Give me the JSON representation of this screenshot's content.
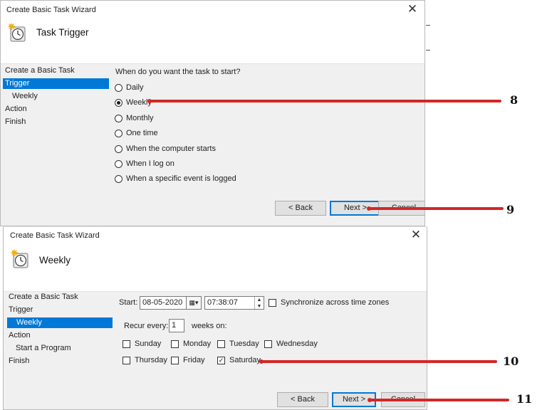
{
  "window1": {
    "title": "Create Basic Task Wizard",
    "close_symbol": "✕",
    "header_title": "Task Trigger",
    "header_icon": "task-scheduler-clock-icon",
    "nav": [
      "Create a Basic Task",
      "Trigger",
      "Weekly",
      "Action",
      "Finish"
    ],
    "nav_active": "Trigger",
    "question": "When do you want the task to start?",
    "options": [
      "Daily",
      "Weekly",
      "Monthly",
      "One time",
      "When the computer starts",
      "When I log on",
      "When a specific event is logged"
    ],
    "selected_option": "Weekly",
    "buttons": {
      "back": "< Back",
      "next": "Next >",
      "cancel": "Cancel"
    }
  },
  "window2": {
    "title": "Create Basic Task Wizard",
    "close_symbol": "✕",
    "header_title": "Weekly",
    "header_icon": "task-scheduler-clock-icon",
    "nav": [
      "Create a Basic Task",
      "Trigger",
      "Weekly",
      "Action",
      "Start a Program",
      "Finish"
    ],
    "nav_active": "Weekly",
    "start_label": "Start:",
    "start_date": "08-05-2020",
    "start_time": "07:38:07",
    "sync_label": "Synchronize across time zones",
    "recur_label": "Recur every:",
    "recur_value": "1",
    "weeks_on_label": "weeks on:",
    "days": [
      {
        "label": "Sunday",
        "checked": false
      },
      {
        "label": "Monday",
        "checked": false
      },
      {
        "label": "Tuesday",
        "checked": false
      },
      {
        "label": "Wednesday",
        "checked": false
      },
      {
        "label": "Thursday",
        "checked": false
      },
      {
        "label": "Friday",
        "checked": false
      },
      {
        "label": "Saturday",
        "checked": true
      }
    ],
    "buttons": {
      "back": "< Back",
      "next": "Next >",
      "cancel": "Cancel"
    }
  },
  "annotations": [
    "8",
    "9",
    "10",
    "11"
  ],
  "annotation_color": "#d42626",
  "accent_color": "#0078d7"
}
